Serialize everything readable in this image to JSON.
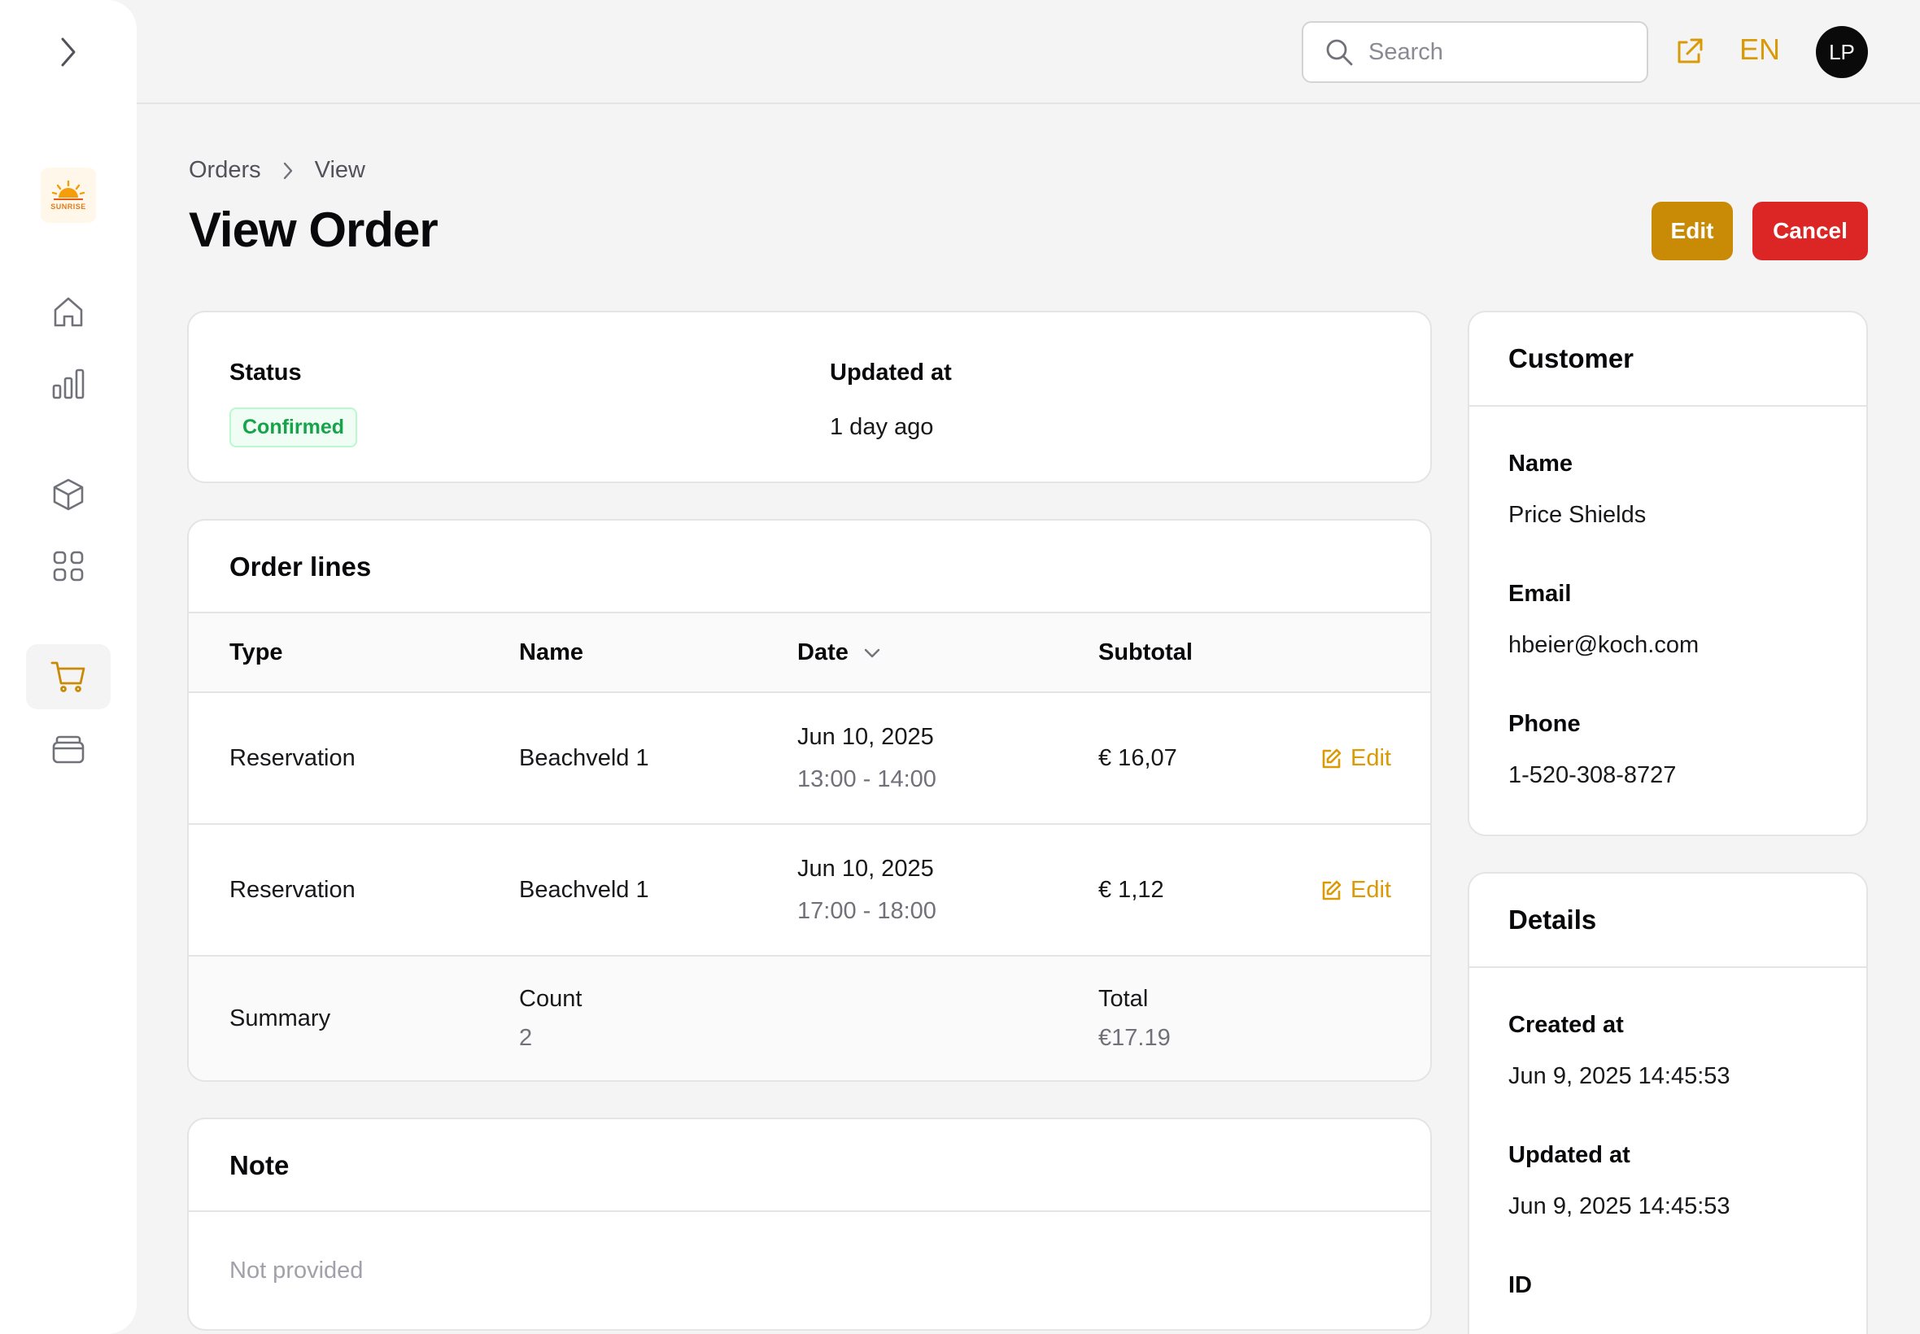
{
  "topbar": {
    "search_placeholder": "Search",
    "language": "EN",
    "avatar_initials": "LP"
  },
  "sidebar": {
    "logo_text": "SUNRISE",
    "items": [
      {
        "icon": "home-icon"
      },
      {
        "icon": "bar-chart-icon"
      },
      {
        "icon": "box-icon"
      },
      {
        "icon": "grid-icon"
      },
      {
        "icon": "cart-icon",
        "active": true
      },
      {
        "icon": "stack-icon"
      }
    ]
  },
  "breadcrumb": [
    "Orders",
    "View"
  ],
  "page": {
    "title": "View Order",
    "edit_label": "Edit",
    "cancel_label": "Cancel"
  },
  "status_card": {
    "status_label": "Status",
    "status_value": "Confirmed",
    "updated_label": "Updated at",
    "updated_value": "1 day ago"
  },
  "order_lines": {
    "title": "Order lines",
    "columns": [
      "Type",
      "Name",
      "Date",
      "Subtotal"
    ],
    "rows": [
      {
        "type": "Reservation",
        "name": "Beachveld 1",
        "date": "Jun 10, 2025",
        "time": "13:00 - 14:00",
        "subtotal": "€ 16,07",
        "action": "Edit"
      },
      {
        "type": "Reservation",
        "name": "Beachveld 1",
        "date": "Jun 10, 2025",
        "time": "17:00 - 18:00",
        "subtotal": "€ 1,12",
        "action": "Edit"
      }
    ],
    "summary": {
      "label": "Summary",
      "count_label": "Count",
      "count_value": "2",
      "total_label": "Total",
      "total_value": "€17.19"
    }
  },
  "note": {
    "title": "Note",
    "value": "Not provided"
  },
  "customer": {
    "title": "Customer",
    "name_label": "Name",
    "name_value": "Price Shields",
    "email_label": "Email",
    "email_value": "hbeier@koch.com",
    "phone_label": "Phone",
    "phone_value": "1-520-308-8727"
  },
  "details": {
    "title": "Details",
    "created_label": "Created at",
    "created_value": "Jun 9, 2025 14:45:53",
    "updated_label": "Updated at",
    "updated_value": "Jun 9, 2025 14:45:53",
    "id_label": "ID"
  },
  "colors": {
    "accent": "#c98a06",
    "danger": "#dc2626",
    "success": "#16a34a"
  }
}
